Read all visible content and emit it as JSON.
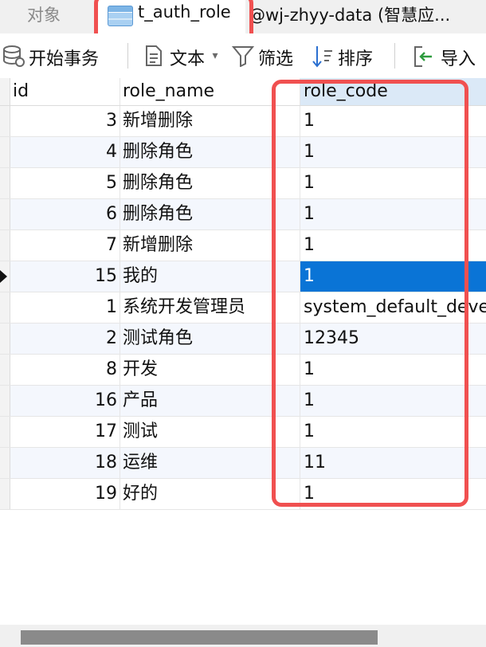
{
  "tabs": {
    "objects_label": "对象",
    "active_title": "t_auth_role",
    "active_db": "@wj-zhyy-data (智慧应..."
  },
  "toolbar": {
    "begin_transaction": "开始事务",
    "text": "文本",
    "filter": "筛选",
    "sort": "排序",
    "import": "导入"
  },
  "grid": {
    "columns": [
      "id",
      "role_name",
      "role_code"
    ],
    "rows": [
      {
        "id": "3",
        "role_name": "新增删除",
        "role_code": "1"
      },
      {
        "id": "4",
        "role_name": "删除角色",
        "role_code": "1"
      },
      {
        "id": "5",
        "role_name": "删除角色",
        "role_code": "1"
      },
      {
        "id": "6",
        "role_name": "删除角色",
        "role_code": "1"
      },
      {
        "id": "7",
        "role_name": "新增删除",
        "role_code": "1"
      },
      {
        "id": "15",
        "role_name": "我的",
        "role_code": "1"
      },
      {
        "id": "1",
        "role_name": "系统开发管理员",
        "role_code": "system_default_developer"
      },
      {
        "id": "2",
        "role_name": "测试角色",
        "role_code": "12345"
      },
      {
        "id": "8",
        "role_name": "开发",
        "role_code": "1"
      },
      {
        "id": "16",
        "role_name": "产品",
        "role_code": "1"
      },
      {
        "id": "17",
        "role_name": "测试",
        "role_code": "1"
      },
      {
        "id": "18",
        "role_name": "运维",
        "role_code": "11"
      },
      {
        "id": "19",
        "role_name": "好的",
        "role_code": "1"
      }
    ]
  },
  "colors": {
    "highlight": "#f05050",
    "selection": "#0a74d6"
  }
}
